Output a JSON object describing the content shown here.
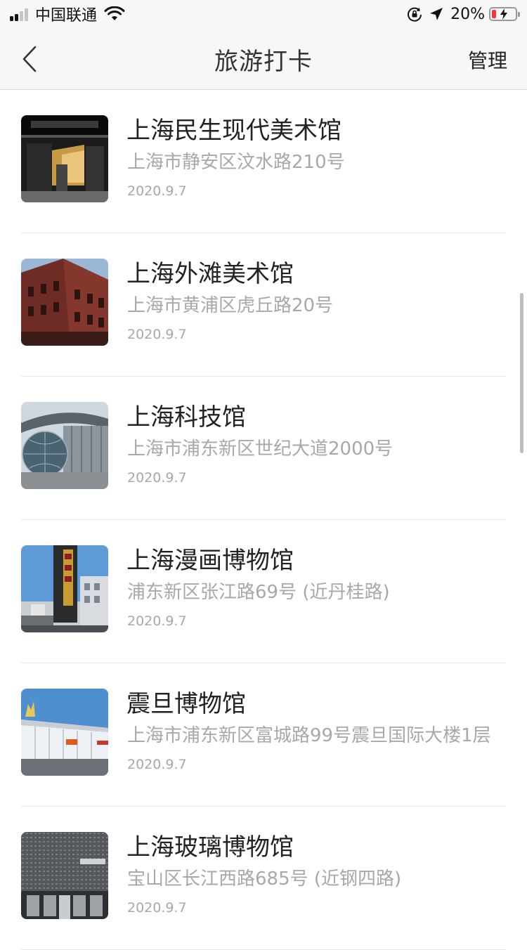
{
  "status_bar": {
    "carrier": "中国联通",
    "battery_percent": "20%",
    "battery_level": 0.2,
    "signal_bars_active": 2,
    "icons": [
      "signal-icon",
      "wifi-icon",
      "rotation-lock-icon",
      "location-arrow-icon",
      "battery-charging-icon"
    ]
  },
  "nav": {
    "title": "旅游打卡",
    "manage_label": "管理",
    "back_icon": "chevron-left-icon"
  },
  "places": [
    {
      "name": "上海民生现代美术馆",
      "address": "上海市静安区汶水路210号",
      "date": "2020.9.7",
      "thumb": "dark-museum-entrance"
    },
    {
      "name": "上海外滩美术馆",
      "address": "上海市黄浦区虎丘路20号",
      "date": "2020.9.7",
      "thumb": "red-brick-building"
    },
    {
      "name": "上海科技馆",
      "address": "上海市浦东新区世纪大道2000号",
      "date": "2020.9.7",
      "thumb": "glass-sphere-building"
    },
    {
      "name": "上海漫画博物馆",
      "address": "浦东新区张江路69号 (近丹桂路)",
      "date": "2020.9.7",
      "thumb": "tower-sign-building"
    },
    {
      "name": "震旦博物馆",
      "address": "上海市浦东新区富城路99号震旦国际大楼1层",
      "date": "2020.9.7",
      "thumb": "white-low-building"
    },
    {
      "name": "上海玻璃博物馆",
      "address": "宝山区长江西路685号 (近钢四路)",
      "date": "2020.9.7",
      "thumb": "grey-facade-building"
    }
  ],
  "colors": {
    "bar_background": "#f7f7f7",
    "primary_text": "#222222",
    "secondary_text": "#a8a8a8",
    "divider": "#e4e4e4",
    "battery_low": "#ff3333"
  }
}
